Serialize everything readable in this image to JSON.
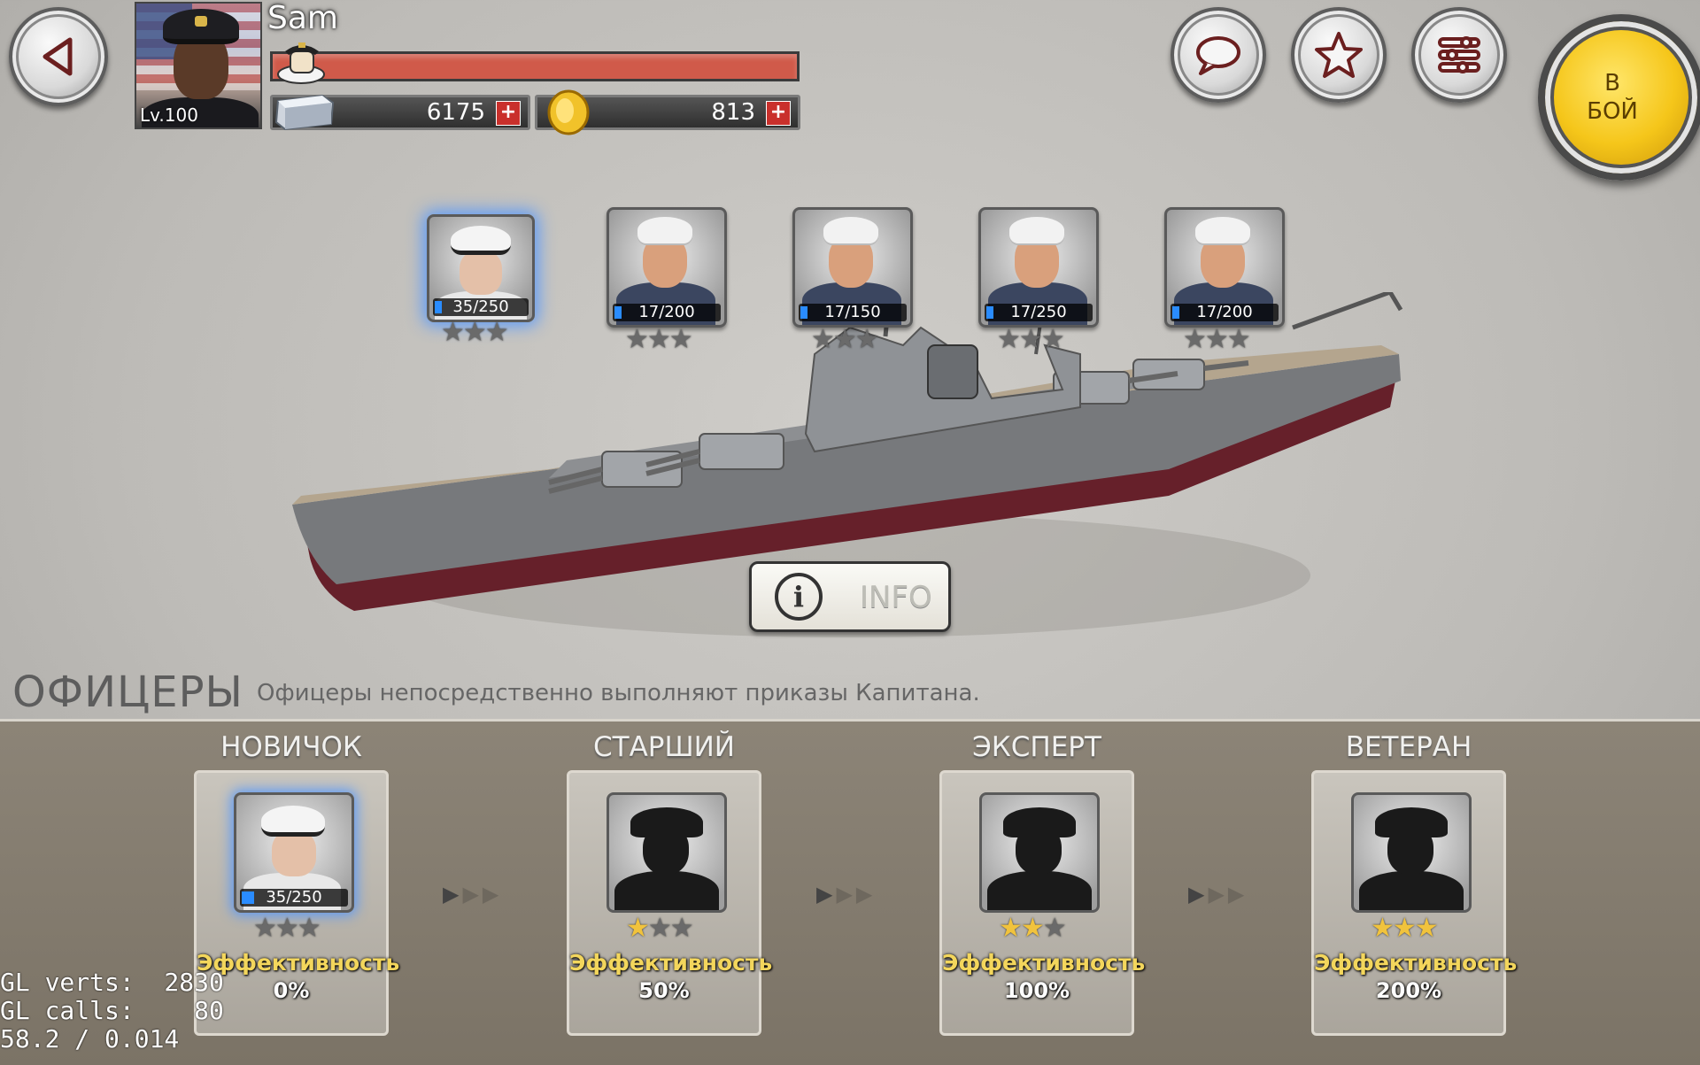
{
  "player": {
    "name": "Sam",
    "level_label": "Lv.100",
    "hp_fraction": 1.0
  },
  "resources": {
    "steel": {
      "value": "6175",
      "plus": "+"
    },
    "gold": {
      "value": "813",
      "plus": "+"
    }
  },
  "battle_button": {
    "line1": "В",
    "line2": "БОЙ"
  },
  "crew": [
    {
      "xp": "35/250",
      "xp_fraction": 0.14,
      "stars_gold": 0
    },
    {
      "xp": "17/200",
      "xp_fraction": 0.085,
      "stars_gold": 0
    },
    {
      "xp": "17/150",
      "xp_fraction": 0.11,
      "stars_gold": 0
    },
    {
      "xp": "17/250",
      "xp_fraction": 0.07,
      "stars_gold": 0
    },
    {
      "xp": "17/200",
      "xp_fraction": 0.085,
      "stars_gold": 0
    }
  ],
  "info_button": {
    "label": "INFO"
  },
  "officers": {
    "title": "ОФИЦЕРЫ",
    "description": "Офицеры непосредственно выполняют приказы Капитана.",
    "ranks": [
      {
        "name": "НОВИЧОК",
        "xp": "35/250",
        "stars_gold": 0,
        "eff_label": "Эффективность",
        "eff_value": "0%"
      },
      {
        "name": "СТАРШИЙ",
        "stars_gold": 1,
        "eff_label": "Эффективность",
        "eff_value": "50%"
      },
      {
        "name": "ЭКСПЕРТ",
        "stars_gold": 2,
        "eff_label": "Эффективность",
        "eff_value": "100%"
      },
      {
        "name": "ВЕТЕРАН",
        "stars_gold": 3,
        "eff_label": "Эффективность",
        "eff_value": "200%"
      }
    ]
  },
  "debug": {
    "line1": "GL verts:  2830",
    "line2": "GL calls:    80",
    "line3": "58.2 / 0.014"
  },
  "icons": [
    "back-arrow-icon",
    "chat-icon",
    "star-icon",
    "settings-sliders-icon",
    "steel-ingot-icon",
    "gold-coin-icon",
    "info-icon",
    "rank-insignia-icon"
  ]
}
